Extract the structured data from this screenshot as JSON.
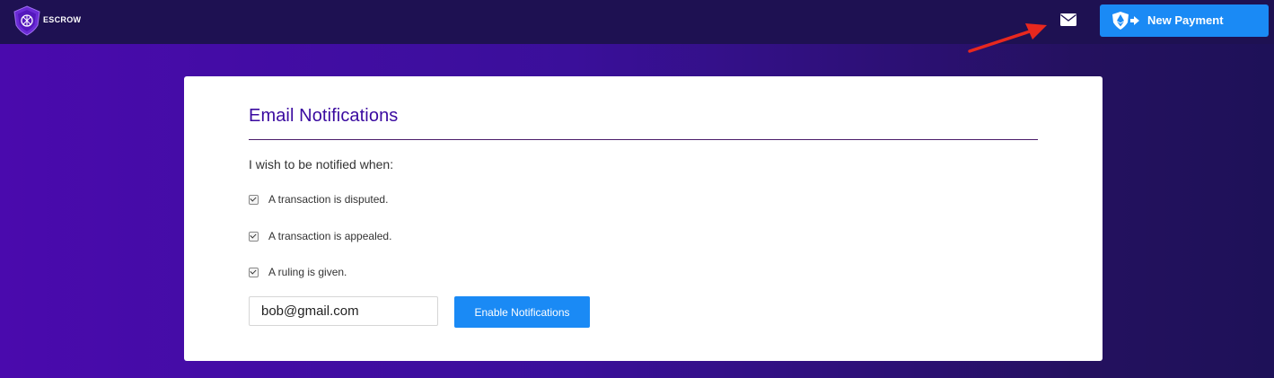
{
  "header": {
    "logo_icon": "escrow-shield-logo-icon",
    "logo_text": "ESCROW",
    "mail_icon": "envelope-icon",
    "new_payment": {
      "icon": "ethereum-shield-arrow-icon",
      "label": "New Payment"
    },
    "annotation_arrow_color": "#e8281e"
  },
  "card": {
    "title": "Email Notifications",
    "intro": "I wish to be notified when:",
    "options": [
      {
        "label": "A transaction is disputed.",
        "checked": true
      },
      {
        "label": "A transaction is appealed.",
        "checked": true
      },
      {
        "label": "A ruling is given.",
        "checked": true
      }
    ],
    "email": {
      "value": "bob@gmail.com"
    },
    "enable_button": "Enable Notifications"
  },
  "colors": {
    "accent": "#1a8af5",
    "title": "#3a0aa0",
    "topbar": "#1e1152"
  }
}
